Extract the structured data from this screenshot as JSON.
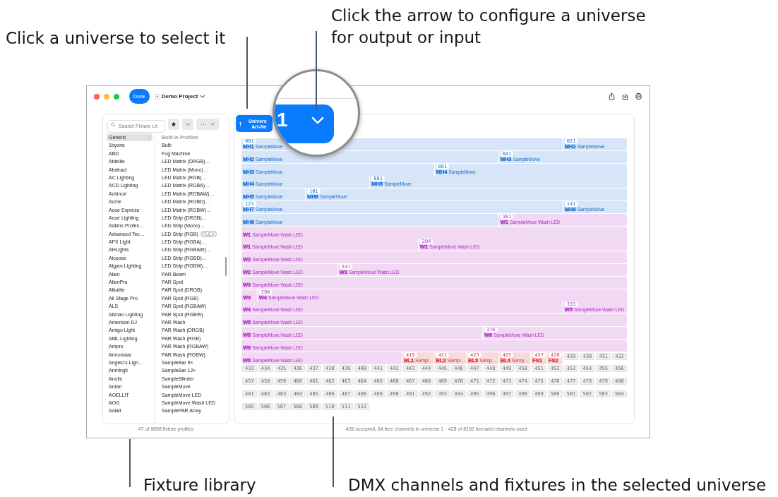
{
  "annotations": [
    {
      "text": "Click a universe to select it"
    },
    {
      "text": "Click the arrow to configure a universe for output or input"
    },
    {
      "text": "Fixture library"
    },
    {
      "text": "DMX channels and fixtures in the selected universe"
    }
  ],
  "window": {
    "done": "Done",
    "title": "Demo Project"
  },
  "library": {
    "search": {
      "placeholder": "Search Fixture Lit"
    },
    "vendors": [
      {
        "label": "Generic",
        "selected": true
      },
      {
        "label": "1byone",
        "selected": false
      },
      {
        "label": "ABD",
        "selected": false
      },
      {
        "label": "Ablelite",
        "selected": false
      },
      {
        "label": "Abstract",
        "selected": false
      },
      {
        "label": "AC Lighting",
        "selected": false
      },
      {
        "label": "ACD Lighting",
        "selected": false
      },
      {
        "label": "Achinori",
        "selected": false
      },
      {
        "label": "Acme",
        "selected": false
      },
      {
        "label": "Acue Express",
        "selected": false
      },
      {
        "label": "Acue Lighting",
        "selected": false
      },
      {
        "label": "Adkins Profes…",
        "selected": false
      },
      {
        "label": "Advanced Tec…",
        "selected": false
      },
      {
        "label": "AFX Light",
        "selected": false
      },
      {
        "label": "AHLights",
        "selected": false
      },
      {
        "label": "Aicpose",
        "selected": false
      },
      {
        "label": "Algam Lighting",
        "selected": false
      },
      {
        "label": "Alien",
        "selected": false
      },
      {
        "label": "AlienPro",
        "selected": false
      },
      {
        "label": "Alkalite",
        "selected": false
      },
      {
        "label": "All Stage Pro",
        "selected": false
      },
      {
        "label": "ALS",
        "selected": false
      },
      {
        "label": "Altman Lighting",
        "selected": false
      },
      {
        "label": "American DJ",
        "selected": false
      },
      {
        "label": "Amigo Light",
        "selected": false
      },
      {
        "label": "AML Lighting",
        "selected": false
      },
      {
        "label": "Ampro",
        "selected": false
      },
      {
        "label": "Amronstar",
        "selected": false
      },
      {
        "label": "Angelo's Ligh…",
        "selected": false
      },
      {
        "label": "Anmingli",
        "selected": false
      },
      {
        "label": "Anolis",
        "selected": false
      },
      {
        "label": "Antari",
        "selected": false
      },
      {
        "label": "AOELLIT",
        "selected": false
      },
      {
        "label": "AOG",
        "selected": false
      },
      {
        "label": "Aolait",
        "selected": false
      }
    ],
    "profiles_header": "Built-in Profiles",
    "profiles": [
      {
        "label": "Bulb"
      },
      {
        "label": "Fog Machine"
      },
      {
        "label": "LED Matrix (DRGB)…"
      },
      {
        "label": "LED Matrix (Mono)…"
      },
      {
        "label": "LED Matrix (RGB)…"
      },
      {
        "label": "LED Matrix (RGBA)…"
      },
      {
        "label": "LED Matrix (RGBAW)…"
      },
      {
        "label": "LED Matrix (RGBD)…"
      },
      {
        "label": "LED Matrix (RGBW)…"
      },
      {
        "label": "LED Strip (DRGB)…"
      },
      {
        "label": "LED Strip (Mono)…"
      },
      {
        "label": "LED Strip (RGB)",
        "badge": "FLEX"
      },
      {
        "label": "LED Strip (RGBA)…"
      },
      {
        "label": "LED Strip (RGBAW)…"
      },
      {
        "label": "LED Strip (RGBD)…"
      },
      {
        "label": "LED Strip (RGBW)…"
      },
      {
        "label": "PAR Beam"
      },
      {
        "label": "PAR Spot"
      },
      {
        "label": "PAR Spot (DRGB)"
      },
      {
        "label": "PAR Spot (RGB)"
      },
      {
        "label": "PAR Spot (RGBAW)"
      },
      {
        "label": "PAR Spot (RGBW)"
      },
      {
        "label": "PAR Wash"
      },
      {
        "label": "PAR Wash (DRGB)"
      },
      {
        "label": "PAR Wash (RGB)"
      },
      {
        "label": "PAR Wash (RGBAW)"
      },
      {
        "label": "PAR Wash (RGBW)"
      },
      {
        "label": "SampleBar 9×"
      },
      {
        "label": "SampleBar 12×"
      },
      {
        "label": "SampleBlinder"
      },
      {
        "label": "SampleMove"
      },
      {
        "label": "SampleMove LED"
      },
      {
        "label": "SampleMove Wash LED"
      },
      {
        "label": "SamplePAR Array"
      }
    ],
    "footer": "47 of 6858 fixture profiles"
  },
  "universe": {
    "tab": {
      "title": "Univers",
      "subtitle": "Art-Ne",
      "selected": true
    },
    "magnifier": {
      "text": "1"
    },
    "rows": [
      {
        "segments": [
          {
            "kind": "fixture",
            "address": "001",
            "name": "MH1",
            "type": "SampleMove",
            "color": "#1a6fd8"
          },
          {
            "kind": "fixture",
            "address": "021",
            "name": "MH2",
            "type": "SampleMove",
            "color": "#1a6fd8"
          }
        ]
      },
      {
        "segments": [
          {
            "kind": "fixture",
            "name": "MH2",
            "type": "SampleMove",
            "color": "#1a6fd8"
          },
          {
            "kind": "fixture",
            "address": "041",
            "name": "MH3",
            "type": "SampleMove",
            "color": "#1a6fd8"
          }
        ]
      },
      {
        "segments": [
          {
            "kind": "fixture",
            "name": "MH3",
            "type": "SampleMove",
            "color": "#1a6fd8"
          },
          {
            "kind": "fixture",
            "address": "061",
            "name": "MH4",
            "type": "SampleMove",
            "color": "#1a6fd8"
          }
        ]
      },
      {
        "segments": [
          {
            "kind": "fixture",
            "name": "MH4",
            "type": "SampleMove",
            "color": "#1a6fd8"
          },
          {
            "kind": "fixture",
            "address": "081",
            "name": "MH5",
            "type": "SampleMove",
            "color": "#1a6fd8"
          }
        ]
      },
      {
        "segments": [
          {
            "kind": "fixture",
            "name": "MH5",
            "type": "SampleMove",
            "color": "#1a6fd8"
          },
          {
            "kind": "fixture",
            "address": "101",
            "name": "MH6",
            "type": "SampleMove",
            "color": "#1a6fd8"
          }
        ]
      },
      {
        "segments": [
          {
            "kind": "fixture",
            "address": "121",
            "name": "MH7",
            "type": "SampleMove",
            "color": "#1a6fd8"
          },
          {
            "kind": "fixture",
            "address": "141",
            "name": "MH8",
            "type": "SampleMove",
            "color": "#1a6fd8"
          }
        ]
      },
      {
        "segments": [
          {
            "kind": "fixture",
            "name": "MH8",
            "type": "SampleMove",
            "color": "#1a6fd8"
          },
          {
            "kind": "fixture",
            "address": "161",
            "name": "W1",
            "type": "SampleMove Wash LED",
            "color": "#b02cc2"
          }
        ]
      },
      {
        "segments": [
          {
            "kind": "fixture",
            "name": "W1",
            "type": "SampleMove Wash LED",
            "color": "#b02cc2"
          }
        ]
      },
      {
        "segments": [
          {
            "kind": "fixture",
            "name": "W1",
            "type": "SampleMove Wash LED",
            "color": "#b02cc2"
          },
          {
            "kind": "fixture",
            "address": "204",
            "name": "W2",
            "type": "SampleMove Wash LED",
            "color": "#b02cc2"
          }
        ]
      },
      {
        "segments": [
          {
            "kind": "fixture",
            "name": "W2",
            "type": "SampleMove Wash LED",
            "color": "#b02cc2"
          }
        ]
      },
      {
        "segments": [
          {
            "kind": "fixture",
            "name": "W2",
            "type": "SampleMove Wash LED",
            "color": "#b02cc2"
          },
          {
            "kind": "fixture",
            "address": "247",
            "name": "W3",
            "type": "SampleMove Wash LED",
            "color": "#b02cc2"
          }
        ]
      },
      {
        "segments": [
          {
            "kind": "fixture",
            "name": "W3",
            "type": "SampleMove Wash LED",
            "color": "#b02cc2"
          }
        ]
      },
      {
        "segments": [
          {
            "kind": "fixture",
            "name": "W3",
            "color": "#b02cc2"
          },
          {
            "kind": "fixture",
            "address": "290",
            "name": "W4",
            "type": "SampleMove Wash LED",
            "color": "#b02cc2"
          }
        ]
      },
      {
        "segments": [
          {
            "kind": "fixture",
            "name": "W4",
            "type": "SampleMove Wash LED",
            "color": "#b02cc2"
          },
          {
            "kind": "fixture",
            "address": "333",
            "name": "W5",
            "type": "SampleMove Wash LED",
            "color": "#b02cc2"
          }
        ]
      },
      {
        "segments": [
          {
            "kind": "fixture",
            "name": "W5",
            "type": "SampleMove Wash LED",
            "color": "#b02cc2"
          }
        ]
      },
      {
        "segments": [
          {
            "kind": "fixture",
            "name": "W5",
            "type": "SampleMove Wash LED",
            "color": "#b02cc2"
          },
          {
            "kind": "fixture",
            "address": "376",
            "name": "W6",
            "type": "SampleMove Wash LED",
            "color": "#b02cc2"
          }
        ]
      },
      {
        "segments": [
          {
            "kind": "fixture",
            "name": "W6",
            "type": "SampleMove Wash LED",
            "color": "#b02cc2"
          }
        ]
      },
      {
        "segments": [
          {
            "kind": "fixture",
            "name": "W6",
            "type": "SampleMove Wash LED",
            "color": "#b02cc2"
          },
          {
            "kind": "fixture",
            "address": "419",
            "name": "BL1",
            "type": "Sampl…",
            "color": "#e0303a"
          },
          {
            "kind": "fixture",
            "address": "421",
            "name": "BL2",
            "type": "Sampl…",
            "color": "#e0303a"
          },
          {
            "kind": "fixture",
            "address": "423",
            "name": "BL3",
            "type": "Samp…",
            "color": "#e0303a"
          },
          {
            "kind": "fixture",
            "address": "425",
            "name": "BL4",
            "type": "Samp…",
            "color": "#e0303a"
          },
          {
            "kind": "fixture",
            "address": "427",
            "name": "FS1",
            "color": "#e0303a"
          },
          {
            "kind": "fixture",
            "address": "428",
            "name": "FS2",
            "color": "#e0303a"
          },
          {
            "kind": "free",
            "address": "429"
          },
          {
            "kind": "free",
            "address": "430"
          },
          {
            "kind": "free",
            "address": "431"
          },
          {
            "kind": "free",
            "address": "432"
          }
        ]
      },
      {
        "segments": [
          {
            "kind": "free",
            "address": "433"
          },
          {
            "kind": "free",
            "address": "434"
          },
          {
            "kind": "free",
            "address": "435"
          },
          {
            "kind": "free",
            "address": "436"
          },
          {
            "kind": "free",
            "address": "437"
          },
          {
            "kind": "free",
            "address": "438"
          },
          {
            "kind": "free",
            "address": "439"
          },
          {
            "kind": "free",
            "address": "440"
          },
          {
            "kind": "free",
            "address": "441"
          },
          {
            "kind": "free",
            "address": "442"
          },
          {
            "kind": "free",
            "address": "443"
          },
          {
            "kind": "free",
            "address": "444"
          },
          {
            "kind": "free",
            "address": "445"
          },
          {
            "kind": "free",
            "address": "446"
          },
          {
            "kind": "free",
            "address": "447"
          },
          {
            "kind": "free",
            "address": "448"
          },
          {
            "kind": "free",
            "address": "449"
          },
          {
            "kind": "free",
            "address": "450"
          },
          {
            "kind": "free",
            "address": "451"
          },
          {
            "kind": "free",
            "address": "452"
          },
          {
            "kind": "free",
            "address": "453"
          },
          {
            "kind": "free",
            "address": "454"
          },
          {
            "kind": "free",
            "address": "455"
          },
          {
            "kind": "free",
            "address": "456"
          }
        ]
      },
      {
        "segments": [
          {
            "kind": "free",
            "address": "457"
          },
          {
            "kind": "free",
            "address": "458"
          },
          {
            "kind": "free",
            "address": "459"
          },
          {
            "kind": "free",
            "address": "460"
          },
          {
            "kind": "free",
            "address": "461"
          },
          {
            "kind": "free",
            "address": "462"
          },
          {
            "kind": "free",
            "address": "463"
          },
          {
            "kind": "free",
            "address": "464"
          },
          {
            "kind": "free",
            "address": "465"
          },
          {
            "kind": "free",
            "address": "466"
          },
          {
            "kind": "free",
            "address": "467"
          },
          {
            "kind": "free",
            "address": "468"
          },
          {
            "kind": "free",
            "address": "469"
          },
          {
            "kind": "free",
            "address": "470"
          },
          {
            "kind": "free",
            "address": "471"
          },
          {
            "kind": "free",
            "address": "472"
          },
          {
            "kind": "free",
            "address": "473"
          },
          {
            "kind": "free",
            "address": "474"
          },
          {
            "kind": "free",
            "address": "475"
          },
          {
            "kind": "free",
            "address": "476"
          },
          {
            "kind": "free",
            "address": "477"
          },
          {
            "kind": "free",
            "address": "478"
          },
          {
            "kind": "free",
            "address": "479"
          },
          {
            "kind": "free",
            "address": "480"
          }
        ]
      },
      {
        "segments": [
          {
            "kind": "free",
            "address": "481"
          },
          {
            "kind": "free",
            "address": "482"
          },
          {
            "kind": "free",
            "address": "483"
          },
          {
            "kind": "free",
            "address": "484"
          },
          {
            "kind": "free",
            "address": "485"
          },
          {
            "kind": "free",
            "address": "486"
          },
          {
            "kind": "free",
            "address": "487"
          },
          {
            "kind": "free",
            "address": "488"
          },
          {
            "kind": "free",
            "address": "489"
          },
          {
            "kind": "free",
            "address": "490"
          },
          {
            "kind": "free",
            "address": "491"
          },
          {
            "kind": "free",
            "address": "492"
          },
          {
            "kind": "free",
            "address": "493"
          },
          {
            "kind": "free",
            "address": "494"
          },
          {
            "kind": "free",
            "address": "495"
          },
          {
            "kind": "free",
            "address": "496"
          },
          {
            "kind": "free",
            "address": "497"
          },
          {
            "kind": "free",
            "address": "498"
          },
          {
            "kind": "free",
            "address": "499"
          },
          {
            "kind": "free",
            "address": "500"
          },
          {
            "kind": "free",
            "address": "501"
          },
          {
            "kind": "free",
            "address": "502"
          },
          {
            "kind": "free",
            "address": "503"
          },
          {
            "kind": "free",
            "address": "504"
          }
        ]
      },
      {
        "segments": [
          {
            "kind": "free",
            "address": "505"
          },
          {
            "kind": "free",
            "address": "506"
          },
          {
            "kind": "free",
            "address": "507"
          },
          {
            "kind": "free",
            "address": "508"
          },
          {
            "kind": "free",
            "address": "509"
          },
          {
            "kind": "free",
            "address": "510"
          },
          {
            "kind": "free",
            "address": "511"
          },
          {
            "kind": "free",
            "address": "512"
          }
        ]
      }
    ],
    "footer": "428 occupied, 84 free channels in universe 1 ·  428 of 8192 licensed channels used"
  }
}
